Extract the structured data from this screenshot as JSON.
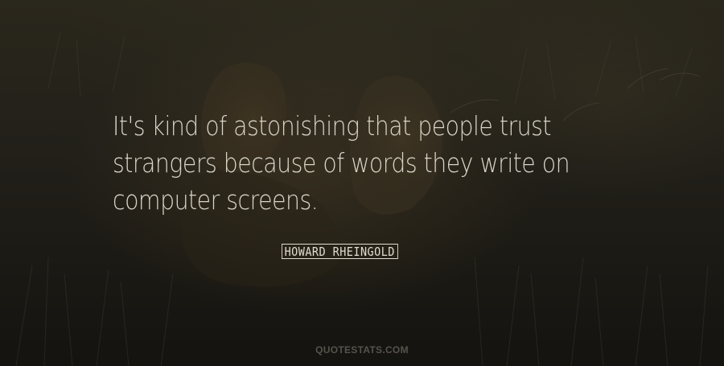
{
  "quote": {
    "lines": [
      "It's kind of astonishing that people trust",
      "strangers because of words they write on",
      "computer screens."
    ]
  },
  "author": {
    "name": "HOWARD RHEINGOLD"
  },
  "watermark": {
    "text": "QUOTESTATS.COM"
  },
  "colors": {
    "text": "#d8d4c8",
    "background": "#1c1a14",
    "watermark": "#55534a"
  }
}
